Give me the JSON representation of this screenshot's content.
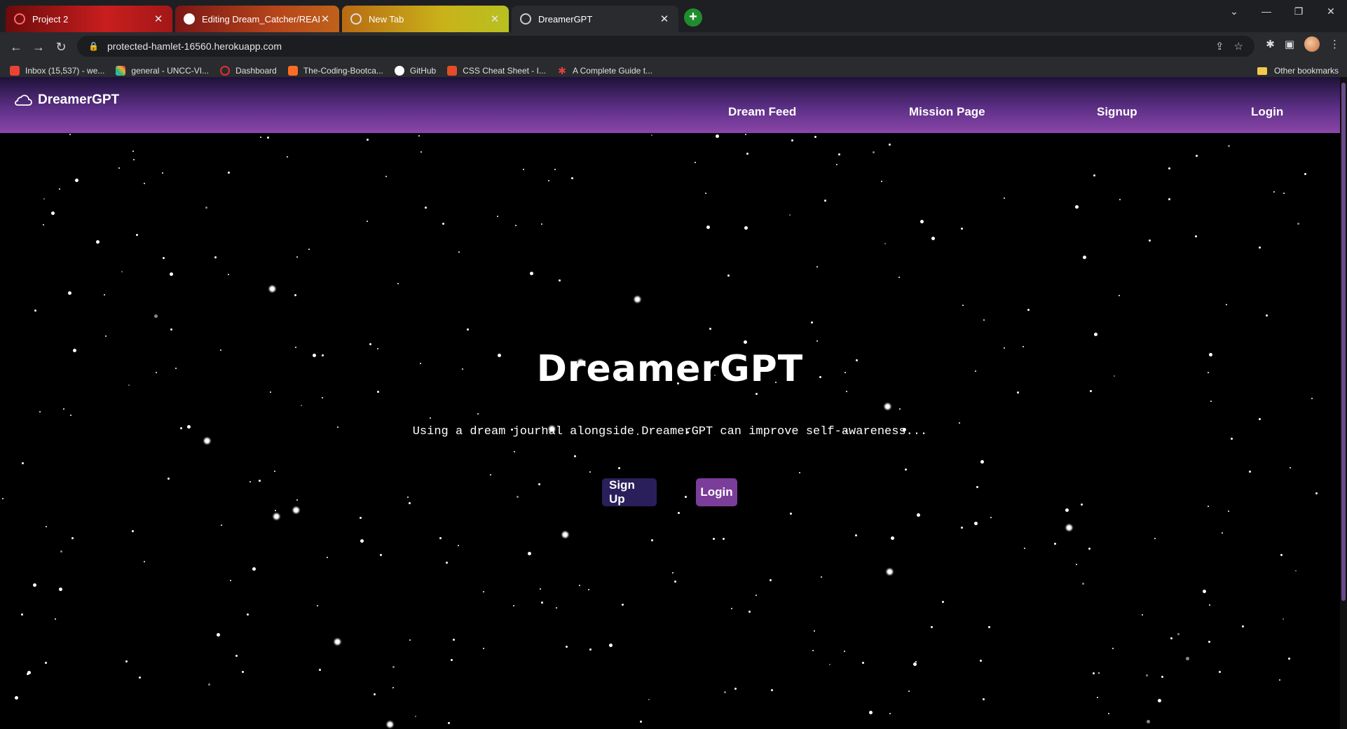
{
  "browser": {
    "tabs": [
      {
        "title": "Project 2",
        "close": "✕"
      },
      {
        "title": "Editing Dream_Catcher/README.",
        "close": "✕"
      },
      {
        "title": "New Tab",
        "close": "✕"
      },
      {
        "title": "DreamerGPT",
        "close": "✕"
      }
    ],
    "new_tab": "+",
    "url": "protected-hamlet-16560.herokuapp.com",
    "bookmarks": [
      {
        "label": "Inbox (15,537) - we...",
        "icon": "gmail-icon",
        "color": "#ea4335"
      },
      {
        "label": "general - UNCC-VI...",
        "icon": "slack-icon",
        "color": "#4a154b"
      },
      {
        "label": "Dashboard",
        "icon": "dashboard-icon",
        "color": "#e03030"
      },
      {
        "label": "The-Coding-Bootca...",
        "icon": "gitlab-icon",
        "color": "#fc6d26"
      },
      {
        "label": "GitHub",
        "icon": "github-icon",
        "color": "#ffffff"
      },
      {
        "label": "CSS Cheat Sheet - I...",
        "icon": "html5-icon",
        "color": "#e44d26"
      },
      {
        "label": "A Complete Guide t...",
        "icon": "asterisk-icon",
        "color": "#e04040"
      }
    ],
    "other_bookmarks": "Other bookmarks"
  },
  "navbar": {
    "brand": "DreamerGPT",
    "links": [
      "Dream Feed",
      "Mission Page",
      "Signup",
      "Login"
    ]
  },
  "hero": {
    "title": "DreamerGPT",
    "subtitle": "Using a dream journal alongside DreamerGPT can improve self-awareness...",
    "signup_label": "Sign Up",
    "login_label": "Login"
  },
  "colors": {
    "nav_gradient_top": "#1d1238",
    "nav_gradient_bottom": "#8a46a8",
    "signup_button": "#2a1f5a",
    "login_button": "#7b3d9a",
    "background": "#000000"
  }
}
